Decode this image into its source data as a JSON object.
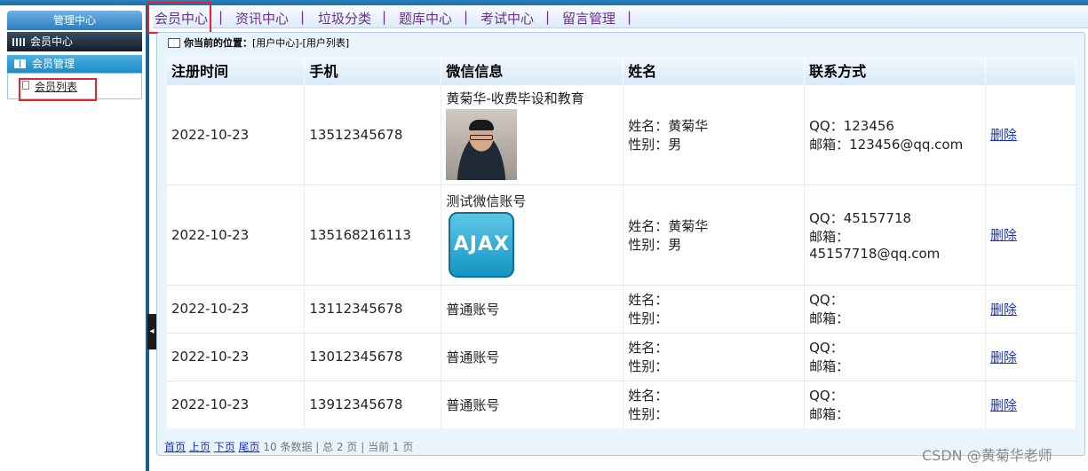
{
  "sidebar": {
    "header": "管理中心",
    "center": "会员中心",
    "group": "会员管理",
    "items": [
      {
        "label": "会员列表"
      }
    ]
  },
  "topnav": {
    "items": [
      {
        "label": "会员中心"
      },
      {
        "label": "资讯中心"
      },
      {
        "label": "垃圾分类"
      },
      {
        "label": "题库中心"
      },
      {
        "label": "考试中心"
      },
      {
        "label": "留言管理"
      }
    ],
    "separator": "|"
  },
  "location": {
    "prefix": "你当前的位置：",
    "path": "[用户中心]-[用户列表]"
  },
  "table": {
    "headers": [
      "注册时间",
      "手机",
      "微信信息",
      "姓名",
      "联系方式",
      ""
    ],
    "name_label": "姓名：",
    "gender_label": "性别：",
    "qq_label": "QQ：",
    "email_label": "邮箱：",
    "delete_label": "删除",
    "rows": [
      {
        "date": "2022-10-23",
        "phone": "13512345678",
        "wechat": "黄菊华-收费毕设和教育",
        "avatar": "photo-avatar",
        "name": "黄菊华",
        "gender": "男",
        "qq": "123456",
        "email": "123456@qq.com"
      },
      {
        "date": "2022-10-23",
        "phone": "135168216113",
        "wechat": "测试微信账号",
        "avatar": "ajax-logo",
        "avatar_text": "AJAX",
        "name": "黄菊华",
        "gender": "男",
        "qq": "45157718",
        "email": "45157718@qq.com"
      },
      {
        "date": "2022-10-23",
        "phone": "13112345678",
        "wechat": "普通账号",
        "name": "",
        "gender": "",
        "qq": "",
        "email": ""
      },
      {
        "date": "2022-10-23",
        "phone": "13012345678",
        "wechat": "普通账号",
        "name": "",
        "gender": "",
        "qq": "",
        "email": ""
      },
      {
        "date": "2022-10-23",
        "phone": "13912345678",
        "wechat": "普通账号",
        "name": "",
        "gender": "",
        "qq": "",
        "email": ""
      }
    ]
  },
  "pager": {
    "first": "首页",
    "prev": "上页",
    "next": "下页",
    "last": "尾页",
    "summary": "10 条数据 | 总 2 页 | 当前 1 页"
  },
  "watermark": "CSDN @黄菊华老师",
  "colors": {
    "nav_text": "#6b2f8f",
    "highlight_box": "#e0252b",
    "link": "#1a33c9"
  }
}
